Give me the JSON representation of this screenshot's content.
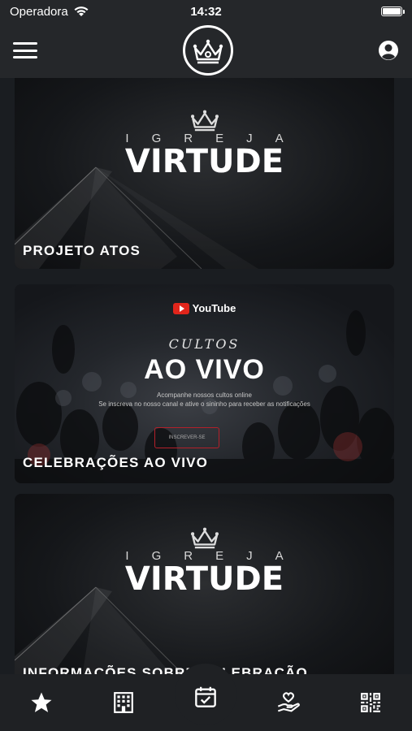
{
  "status_bar": {
    "carrier": "Operadora",
    "time": "14:32"
  },
  "header": {
    "logo_icon": "crown-logo-icon",
    "menu_icon": "hamburger-icon",
    "profile_icon": "user-circle-icon"
  },
  "cards": [
    {
      "title": "PROJETO ATOS",
      "brand_top": "IGREJA",
      "brand_main": "VIRTUDE"
    },
    {
      "title": "CELEBRAÇÕES AO VIVO",
      "youtube": "YouTube",
      "cultos": "CULTOS",
      "ao_vivo": "AO VIVO",
      "line1": "Acompanhe nossos cultos online",
      "line2": "Se inscreva no nosso canal e ative o sininho para receber as notificações",
      "button": "INSCREVER-SE"
    },
    {
      "title": "INFORMAÇÕES SOBRE CELEBRAÇÃO",
      "brand_top": "IGREJA",
      "brand_main": "VIRTUDE"
    }
  ],
  "tabbar": [
    {
      "icon": "star-icon"
    },
    {
      "icon": "building-icon"
    },
    {
      "icon": "calendar-check-icon"
    },
    {
      "icon": "hand-heart-icon"
    },
    {
      "icon": "qr-code-icon"
    }
  ],
  "colors": {
    "background": "#1a1d21",
    "bar": "#25272a",
    "youtube_red": "#e1251b"
  }
}
